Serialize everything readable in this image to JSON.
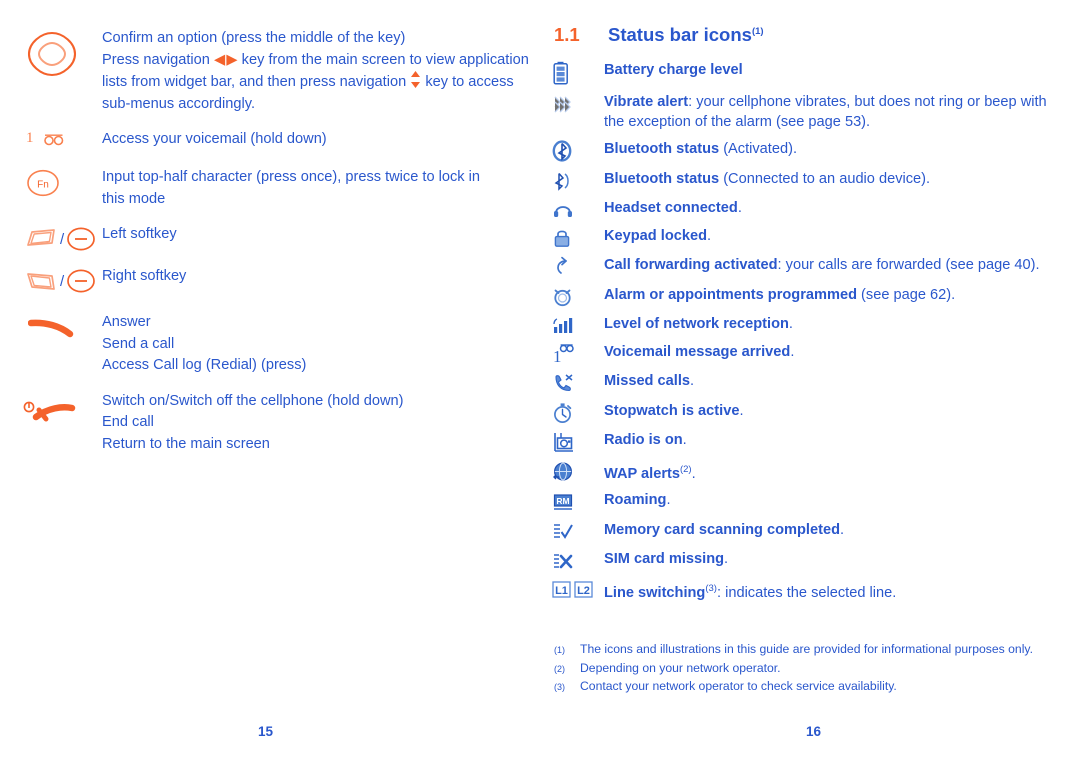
{
  "theme": {
    "text_blue": "#2a57cc",
    "accent_orange": "#f4622b",
    "icon_blue": "#2f66c8",
    "icon_orange_light": "#f9814f"
  },
  "left_page": {
    "page_number": "15",
    "key_rows": [
      {
        "icon": "navigation-key-icon",
        "lines": [
          {
            "type": "plain",
            "text": "Confirm an option (press the middle of the key)"
          },
          {
            "type": "arrows-lr",
            "before": "Press navigation ",
            "after": " key from the main screen to view application"
          },
          {
            "type": "arrows-ud",
            "before": "lists from widget bar, and then press navigation ",
            "after": " key to access"
          },
          {
            "type": "plain",
            "text": "sub-menus accordingly."
          }
        ]
      },
      {
        "icon": "voicemail-key-icon",
        "lines": [
          {
            "type": "plain",
            "text": "Access your voicemail (hold down)"
          }
        ]
      },
      {
        "icon": "fn-key-icon",
        "lines": [
          {
            "type": "justify",
            "text": "Input top-half character (press once), press twice to lock in"
          },
          {
            "type": "plain",
            "text": "this mode"
          }
        ]
      },
      {
        "icon": "left-softkey-icon",
        "lines": [
          {
            "type": "plain",
            "text": "Left softkey"
          }
        ]
      },
      {
        "icon": "right-softkey-icon",
        "lines": [
          {
            "type": "plain",
            "text": "Right softkey"
          }
        ]
      },
      {
        "icon": "call-key-icon",
        "lines": [
          {
            "type": "plain",
            "text": "Answer"
          },
          {
            "type": "plain",
            "text": "Send a call"
          },
          {
            "type": "plain",
            "text": "Access Call log (Redial) (press)"
          }
        ]
      },
      {
        "icon": "power-end-key-icon",
        "lines": [
          {
            "type": "plain",
            "text": "Switch on/Switch off the cellphone (hold down)"
          },
          {
            "type": "plain",
            "text": "End call"
          },
          {
            "type": "plain",
            "text": "Return to the main screen"
          }
        ]
      }
    ]
  },
  "right_page": {
    "page_number": "16",
    "section": {
      "number": "1.1",
      "title": "Status bar icons",
      "footnote_mark": "(1)"
    },
    "status_items": [
      {
        "icon": "battery-icon",
        "bold": "Battery charge level",
        "rest": ""
      },
      {
        "icon": "vibrate-icon",
        "bold": "Vibrate alert",
        "rest": ": your cellphone vibrates, but does not ring or beep with the exception of the alarm (see page 53)."
      },
      {
        "icon": "bluetooth-activated-icon",
        "bold": "Bluetooth status",
        "rest": " (Activated)."
      },
      {
        "icon": "bluetooth-audio-connected-icon",
        "bold": "Bluetooth status",
        "rest": " (Connected to an audio device)."
      },
      {
        "icon": "headset-icon",
        "bold": "Headset connected",
        "rest": "."
      },
      {
        "icon": "keypad-lock-icon",
        "bold": "Keypad locked",
        "rest": "."
      },
      {
        "icon": "call-forwarding-icon",
        "bold": "Call forwarding activated",
        "rest": ": your calls are forwarded (see page 40)."
      },
      {
        "icon": "alarm-clock-icon",
        "bold": "Alarm or appointments programmed",
        "rest": " (see page 62)."
      },
      {
        "icon": "signal-strength-icon",
        "bold": "Level of network reception",
        "rest": "."
      },
      {
        "icon": "voicemail-message-icon",
        "bold": "Voicemail message arrived",
        "rest": "."
      },
      {
        "icon": "missed-calls-icon",
        "bold": "Missed calls",
        "rest": "."
      },
      {
        "icon": "stopwatch-icon",
        "bold": "Stopwatch is active",
        "rest": "."
      },
      {
        "icon": "radio-icon",
        "bold": "Radio is on",
        "rest": "."
      },
      {
        "icon": "wap-alert-icon",
        "bold": "WAP alerts",
        "rest_sup": "(2)",
        "rest": "."
      },
      {
        "icon": "roaming-icon",
        "bold": "Roaming",
        "rest": "."
      },
      {
        "icon": "memory-card-scan-icon",
        "bold": "Memory card scanning completed",
        "rest": "."
      },
      {
        "icon": "sim-card-missing-icon",
        "bold": "SIM card missing",
        "rest": "."
      },
      {
        "icon": "line-switching-icon",
        "bold": "Line switching",
        "rest_sup": "(3)",
        "rest": ": indicates the selected line."
      }
    ],
    "footnotes": [
      {
        "mark": "(1)",
        "text": "The icons and illustrations in this guide are provided for informational purposes only.",
        "justify": true
      },
      {
        "mark": "(2)",
        "text": "Depending on your network operator.",
        "justify": false
      },
      {
        "mark": "(3)",
        "text": "Contact your network operator to check service availability.",
        "justify": false
      }
    ]
  }
}
